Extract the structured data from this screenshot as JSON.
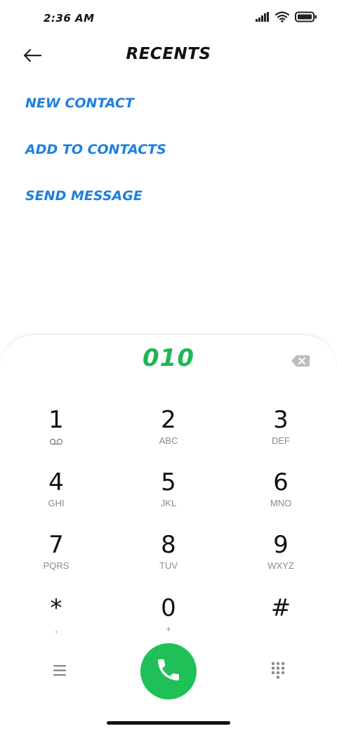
{
  "status_bar": {
    "time": "2:36 AM",
    "icons": [
      "signal-icon",
      "wifi-icon",
      "battery-icon"
    ]
  },
  "header": {
    "back_icon": "back-arrow-icon",
    "title": "RECENTS"
  },
  "actions": [
    {
      "label": "NEW CONTACT"
    },
    {
      "label": "ADD TO CONTACTS"
    },
    {
      "label": "SEND MESSAGE"
    }
  ],
  "dialer": {
    "number": "010",
    "backspace_icon": "backspace-icon",
    "keys": [
      {
        "digit": "1",
        "letters": "",
        "sub_icon": "voicemail-icon"
      },
      {
        "digit": "2",
        "letters": "ABC"
      },
      {
        "digit": "3",
        "letters": "DEF"
      },
      {
        "digit": "4",
        "letters": "GHI"
      },
      {
        "digit": "5",
        "letters": "JKL"
      },
      {
        "digit": "6",
        "letters": "MNO"
      },
      {
        "digit": "7",
        "letters": "PQRS"
      },
      {
        "digit": "8",
        "letters": "TUV"
      },
      {
        "digit": "9",
        "letters": "WXYZ"
      },
      {
        "digit": "*",
        "letters": ","
      },
      {
        "digit": "0",
        "letters": "+"
      },
      {
        "digit": "#",
        "letters": ""
      }
    ]
  },
  "bottom_bar": {
    "menu_icon": "menu-icon",
    "call_icon": "phone-call-icon",
    "keypad_icon": "keypad-grid-icon"
  },
  "colors": {
    "accent_blue": "#1e7fe0",
    "call_green": "#1fc058",
    "number_green": "#1fb654",
    "secondary_gray": "#8a8a8a"
  }
}
